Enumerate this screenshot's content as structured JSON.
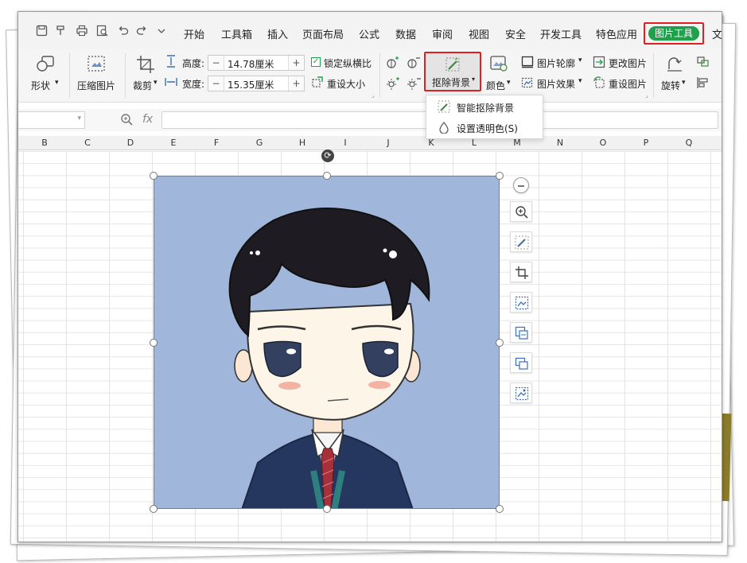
{
  "menubar": {
    "items": [
      "开始",
      "工具箱",
      "插入",
      "页面布局",
      "公式",
      "数据",
      "审阅",
      "视图",
      "安全",
      "开发工具",
      "特色应用"
    ],
    "active_tab": "图片工具",
    "overflow": "文"
  },
  "ribbon": {
    "shape_label": "形状",
    "compress_label": "压缩图片",
    "crop_label": "裁剪",
    "height_label": "高度:",
    "height_value": "14.78厘米",
    "width_label": "宽度:",
    "width_value": "15.35厘米",
    "lock_ratio_label": "锁定纵横比",
    "resize_label": "重设大小",
    "remove_bg_label": "抠除背景",
    "color_label": "颜色",
    "outline_label": "图片轮廓",
    "effect_label": "图片效果",
    "change_pic_label": "更改图片",
    "reset_pic_label": "重设图片",
    "rotate_label": "旋转"
  },
  "dropdown": {
    "smart_remove_label": "智能抠除背景",
    "set_transparent_label": "设置透明色(S)"
  },
  "formula_bar": {
    "fx_label": "fx"
  },
  "columns": [
    "B",
    "C",
    "D",
    "E",
    "F",
    "G",
    "H",
    "I",
    "J",
    "K",
    "L",
    "M",
    "N",
    "O",
    "P",
    "Q"
  ],
  "colors": {
    "accent": "#1fa14b",
    "highlight": "#e02020",
    "picture_bg": "#a0b6db"
  }
}
